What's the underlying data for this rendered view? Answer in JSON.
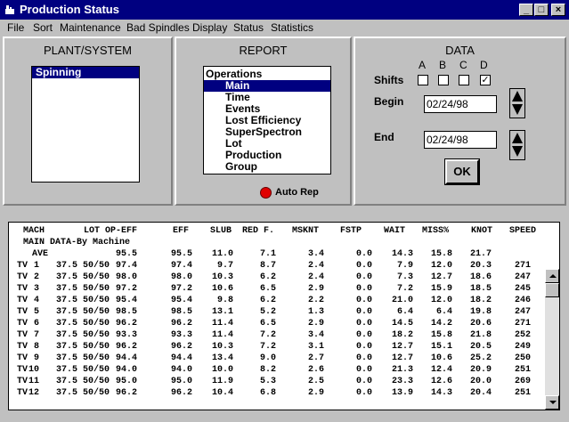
{
  "window": {
    "title": "Production Status",
    "controls": [
      "_",
      "□",
      "×"
    ]
  },
  "menu": [
    "File",
    "Sort",
    "Maintenance",
    "Bad Spindles",
    "Display",
    "Status",
    "Statistics"
  ],
  "plant": {
    "title": "PLANT/SYSTEM",
    "items": [
      "Spinning"
    ],
    "selected_index": 0
  },
  "report": {
    "title": "REPORT",
    "items": [
      "Operations",
      "Main",
      "Time",
      "Events",
      "Lost Efficiency",
      "SuperSpectron",
      "Lot",
      "Production",
      "Group"
    ],
    "selected_index": 1,
    "auto_rep": "Auto Rep",
    "auto_rep_color": "#e00000"
  },
  "data": {
    "title": "DATA",
    "shifts_label": "Shifts",
    "shifts": [
      {
        "label": "A",
        "checked": false,
        "mark": ""
      },
      {
        "label": "B",
        "checked": false,
        "mark": ""
      },
      {
        "label": "C",
        "checked": false,
        "mark": ""
      },
      {
        "label": "D",
        "checked": true,
        "mark": "✓"
      }
    ],
    "begin_label": "Begin",
    "begin_value": "02/24/98",
    "end_label": "End",
    "end_value": "02/24/98",
    "ok_label": "OK"
  },
  "grid": {
    "headers": [
      "MACH",
      "LOT",
      "OP-EFF",
      "EFF",
      "SLUB",
      "RED F.",
      "MSKNT",
      "FSTP",
      "WAIT",
      "MISS%",
      "KNOT",
      "SPEED"
    ],
    "subtitle": "MAIN DATA-By Machine",
    "average": {
      "label": "AVE",
      "op_eff": "95.5",
      "eff": "95.5",
      "slub": "11.0",
      "red_f": "7.1",
      "msknt": "3.4",
      "fstp": "0.0",
      "wait": "14.3",
      "miss": "15.8",
      "knot": "21.7"
    },
    "rows": [
      [
        "TV",
        "1",
        "37.5 50/50",
        "97.4",
        "97.4",
        "9.7",
        "8.7",
        "2.4",
        "0.0",
        "7.9",
        "12.0",
        "20.3",
        "271"
      ],
      [
        "TV",
        "2",
        "37.5 50/50",
        "98.0",
        "98.0",
        "10.3",
        "6.2",
        "2.4",
        "0.0",
        "7.3",
        "12.7",
        "18.6",
        "247"
      ],
      [
        "TV",
        "3",
        "37.5 50/50",
        "97.2",
        "97.2",
        "10.6",
        "6.5",
        "2.9",
        "0.0",
        "7.2",
        "15.9",
        "18.5",
        "245"
      ],
      [
        "TV",
        "4",
        "37.5 50/50",
        "95.4",
        "95.4",
        "9.8",
        "6.2",
        "2.2",
        "0.0",
        "21.0",
        "12.0",
        "18.2",
        "246"
      ],
      [
        "TV",
        "5",
        "37.5 50/50",
        "98.5",
        "98.5",
        "13.1",
        "5.2",
        "1.3",
        "0.0",
        "6.4",
        "6.4",
        "19.8",
        "247"
      ],
      [
        "TV",
        "6",
        "37.5 50/50",
        "96.2",
        "96.2",
        "11.4",
        "6.5",
        "2.9",
        "0.0",
        "14.5",
        "14.2",
        "20.6",
        "271"
      ],
      [
        "TV",
        "7",
        "37.5 50/50",
        "93.3",
        "93.3",
        "11.4",
        "7.2",
        "3.4",
        "0.0",
        "18.2",
        "15.8",
        "21.8",
        "252"
      ],
      [
        "TV",
        "8",
        "37.5 50/50",
        "96.2",
        "96.2",
        "10.3",
        "7.2",
        "3.1",
        "0.0",
        "12.7",
        "15.1",
        "20.5",
        "249"
      ],
      [
        "TV",
        "9",
        "37.5 50/50",
        "94.4",
        "94.4",
        "13.4",
        "9.0",
        "2.7",
        "0.0",
        "12.7",
        "10.6",
        "25.2",
        "250"
      ],
      [
        "TV",
        "10",
        "37.5 50/50",
        "94.0",
        "94.0",
        "10.0",
        "8.2",
        "2.6",
        "0.0",
        "21.3",
        "12.4",
        "20.9",
        "251"
      ],
      [
        "TV",
        "11",
        "37.5 50/50",
        "95.0",
        "95.0",
        "11.9",
        "5.3",
        "2.5",
        "0.0",
        "23.3",
        "12.6",
        "20.0",
        "269"
      ],
      [
        "TV",
        "12",
        "37.5 50/50",
        "96.2",
        "96.2",
        "10.4",
        "6.8",
        "2.9",
        "0.0",
        "13.9",
        "14.3",
        "20.4",
        "251"
      ]
    ]
  }
}
